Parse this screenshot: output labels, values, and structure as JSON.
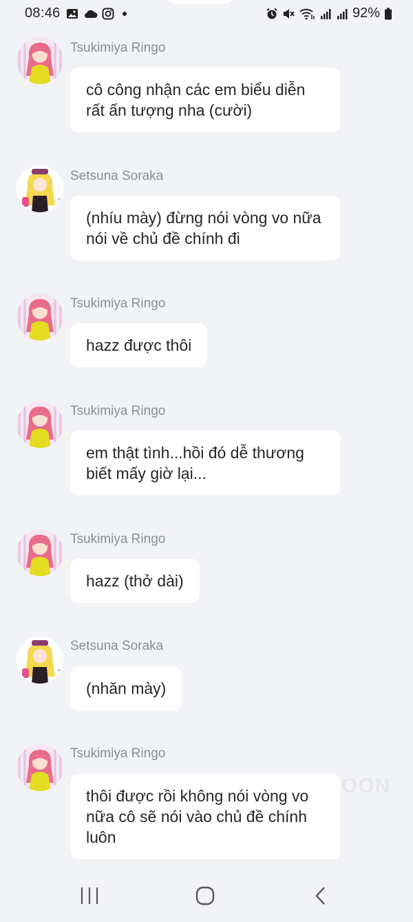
{
  "status_bar": {
    "time": "08:46",
    "battery": "92%",
    "left_icons": [
      "image-icon",
      "cloud-icon",
      "instagram-icon",
      "dot-icon"
    ],
    "right_icons": [
      "alarm-icon",
      "mute-icon",
      "wifi-icon",
      "signal-icon",
      "signal-icon",
      "battery-icon"
    ]
  },
  "messages": [
    {
      "sender": "Tsukimiya Ringo",
      "avatar": "avatar-ringo",
      "text": "cô công nhận các em biểu diễn rất ấn tượng nha (cười)"
    },
    {
      "sender": "Setsuna Soraka",
      "avatar": "avatar-setsuna",
      "text": "(nhíu mày) đừng nói vòng vo nữa nói về chủ đề chính đi"
    },
    {
      "sender": "Tsukimiya Ringo",
      "avatar": "avatar-ringo",
      "text": "hazz được thôi"
    },
    {
      "sender": "Tsukimiya Ringo",
      "avatar": "avatar-ringo",
      "text": "em thật tình...hồi đó dễ thương biết mấy giờ lại..."
    },
    {
      "sender": "Tsukimiya Ringo",
      "avatar": "avatar-ringo",
      "text": "hazz (thở dài)"
    },
    {
      "sender": "Setsuna Soraka",
      "avatar": "avatar-setsuna",
      "text": "(nhăn mày)"
    },
    {
      "sender": "Tsukimiya Ringo",
      "avatar": "avatar-ringo",
      "text": "thôi được rồi không nói vòng vo nữa cô sẽ nói vào chủ đề chính luôn"
    }
  ],
  "watermark": "OON",
  "nav": {
    "buttons": [
      "recent-apps-icon",
      "home-icon",
      "back-icon"
    ]
  }
}
